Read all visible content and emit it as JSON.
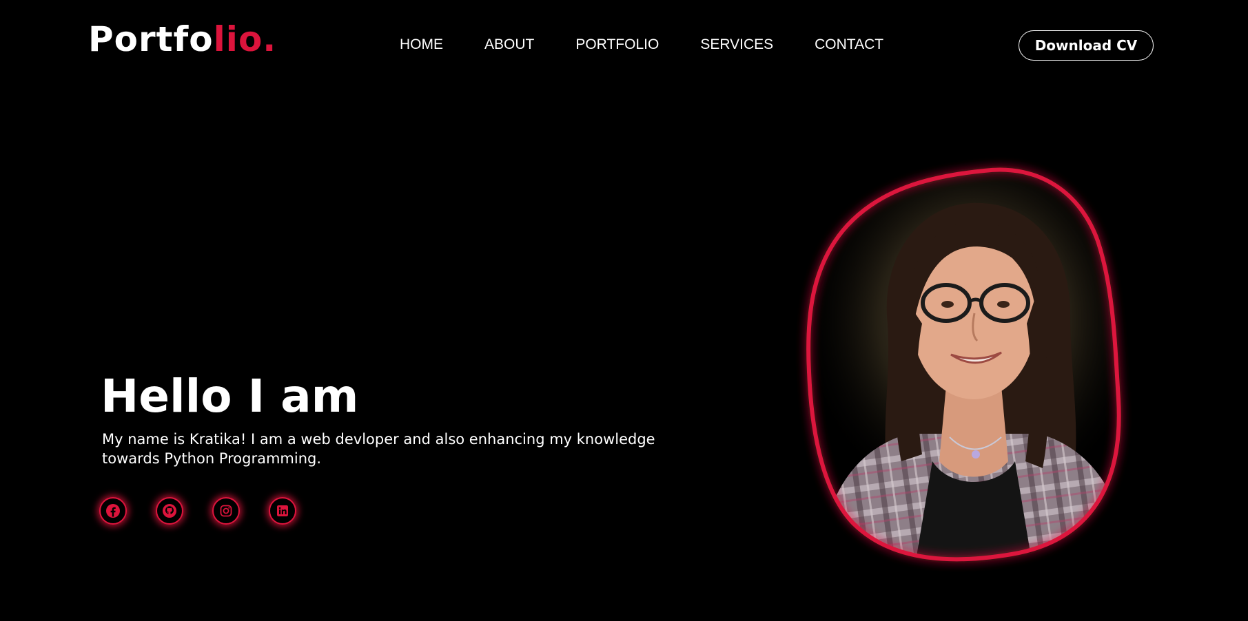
{
  "header": {
    "logo_main": "Portfo",
    "logo_accent": "lio.",
    "nav": [
      "HOME",
      "ABOUT",
      "PORTFOLIO",
      "SERVICES",
      "CONTACT"
    ],
    "cta_label": "Download CV"
  },
  "hero": {
    "title": "Hello I am",
    "description": "My name is Kratika! I am a web devloper and also enhancing my knowledge towards Python Programming."
  },
  "socials": [
    {
      "icon": "facebook-icon"
    },
    {
      "icon": "github-icon"
    },
    {
      "icon": "instagram-icon"
    },
    {
      "icon": "linkedin-icon"
    }
  ],
  "colors": {
    "background": "#000000",
    "accent": "#dc143c",
    "text": "#ffffff"
  }
}
